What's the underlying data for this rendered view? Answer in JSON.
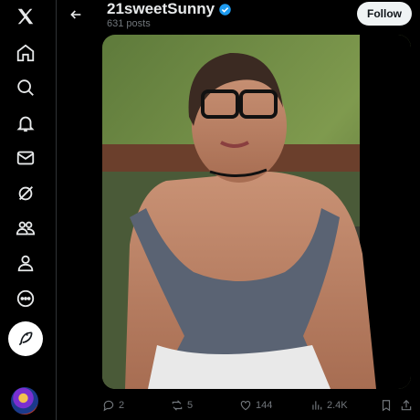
{
  "profile": {
    "name": "21sweetSunny",
    "post_count": "631 posts",
    "follow_label": "Follow"
  },
  "sidebar": {
    "items": [
      "x-logo-icon",
      "home-icon",
      "search-icon",
      "bell-icon",
      "mail-icon",
      "grok-icon",
      "communities-icon",
      "profile-icon",
      "more-icon"
    ]
  },
  "post": {
    "replies": "2",
    "reposts": "5",
    "likes": "144",
    "views": "2.4K"
  },
  "colors": {
    "background": "#000000",
    "text": "#e7e9ea",
    "muted": "#71767b",
    "verified": "#1d9bf0",
    "follow_bg": "#eff3f4"
  }
}
